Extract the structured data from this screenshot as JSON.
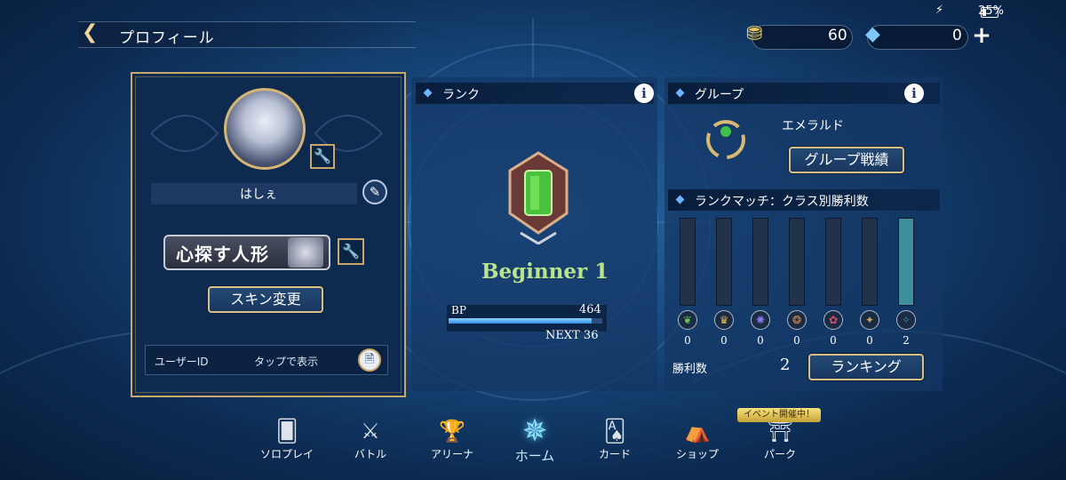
{
  "status": {
    "battery": "25%"
  },
  "header": {
    "title": "プロフィール",
    "gold": "60",
    "crystal": "0"
  },
  "profile": {
    "name": "はしぇ",
    "title_badge": "心探す人形",
    "skin_button": "スキン変更",
    "user_id_label": "ユーザーID",
    "user_id_value": "タップで表示"
  },
  "rank": {
    "section_title": "ランク",
    "name": "Beginner 1",
    "bp_label": "BP",
    "bp_value": "464",
    "bp_progress": 0.93,
    "next": "NEXT 36"
  },
  "group": {
    "section_title": "グループ",
    "name": "エメラルド",
    "button": "グループ戦績"
  },
  "rank_match": {
    "section_title": "ランクマッチ：クラス別勝利数",
    "classes": [
      {
        "icon": "forest-icon",
        "wins": "0",
        "level": 0,
        "color": "#6cc25a"
      },
      {
        "icon": "sword-icon",
        "wins": "0",
        "level": 0,
        "color": "#e0b34a"
      },
      {
        "icon": "rune-icon",
        "wins": "0",
        "level": 0,
        "color": "#8c7cf2"
      },
      {
        "icon": "dragon-icon",
        "wins": "0",
        "level": 0,
        "color": "#e08a4a"
      },
      {
        "icon": "shadow-icon",
        "wins": "0",
        "level": 0,
        "color": "#e04a6a"
      },
      {
        "icon": "blood-icon",
        "wins": "0",
        "level": 0,
        "color": "#c9a35a"
      },
      {
        "icon": "haven-icon",
        "wins": "2",
        "level": 1.0,
        "color": "#3f8e9c"
      }
    ],
    "wins_label": "勝利数",
    "wins_total": "2",
    "ranking_button": "ランキング"
  },
  "nav": {
    "items": [
      {
        "label": "ソロプレイ",
        "icon": "solo-cards-icon"
      },
      {
        "label": "バトル",
        "icon": "crossed-swords-icon"
      },
      {
        "label": "アリーナ",
        "icon": "trophy-icon"
      },
      {
        "label": "ホーム",
        "icon": "home-emblem-icon"
      },
      {
        "label": "カード",
        "icon": "cards-icon"
      },
      {
        "label": "ショップ",
        "icon": "shop-icon"
      },
      {
        "label": "パーク",
        "icon": "park-icon"
      }
    ],
    "event_badge": "イベント開催中！"
  }
}
